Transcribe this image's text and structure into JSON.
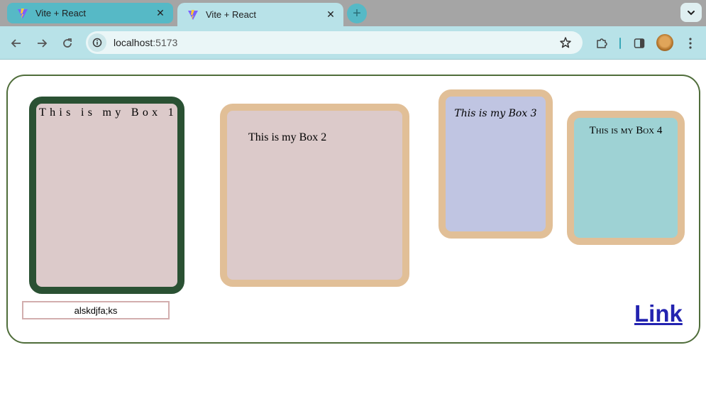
{
  "tabs": [
    {
      "title": "Vite + React",
      "active": false
    },
    {
      "title": "Vite + React",
      "active": true
    }
  ],
  "tab_icons": {
    "favicon": "vite-logo-icon",
    "close": "close-icon",
    "new_tab": "plus-icon",
    "tab_search": "chevron-down-icon"
  },
  "toolbar": {
    "url_host": "localhost",
    "url_port": ":5173",
    "icons": [
      "back-arrow-icon",
      "forward-arrow-icon",
      "reload-icon",
      "site-info-icon",
      "bookmark-star-icon",
      "extensions-puzzle-icon",
      "side-panel-icon",
      "profile-avatar",
      "more-menu-icon"
    ]
  },
  "content": {
    "boxes": [
      {
        "label": "This is my Box 1"
      },
      {
        "label": "This is my Box 2"
      },
      {
        "label": "This is my Box 3"
      },
      {
        "label": "This is my Box 4"
      }
    ],
    "input_value": "alskdjfa;ks",
    "link_text": "Link"
  },
  "colors": {
    "tabstrip": "#a5a5a5",
    "active_tab": "#b8e2e8",
    "inactive_tab": "#56b9c6",
    "container_border": "#4f6d3a",
    "box1_border": "#2a5133",
    "box_border_tan": "#e1bf97",
    "box_fill_pink": "#dccaca",
    "box3_fill": "#c0c5e2",
    "box4_fill": "#9ed2d4",
    "link": "#2323b0"
  }
}
